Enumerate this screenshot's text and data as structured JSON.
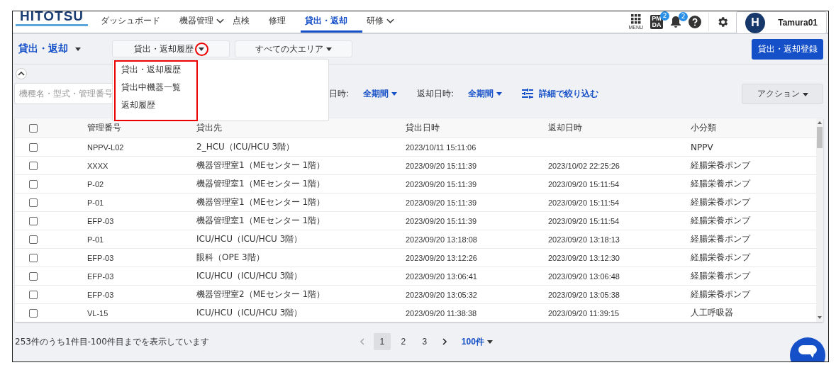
{
  "header": {
    "logo": "HITOTSU",
    "nav": [
      {
        "label": "ダッシュボード",
        "selected": false,
        "has_menu": false
      },
      {
        "label": "機器管理",
        "selected": false,
        "has_menu": true
      },
      {
        "label": "点検",
        "selected": false,
        "has_menu": false
      },
      {
        "label": "修理",
        "selected": false,
        "has_menu": false
      },
      {
        "label": "貸出・返却",
        "selected": true,
        "has_menu": false
      },
      {
        "label": "研修",
        "selected": false,
        "has_menu": true
      }
    ],
    "menu_label": "MENU",
    "pmda_label": "PMDA",
    "pmda_badge": "2",
    "bell_badge": "2",
    "avatar_letter": "H",
    "user": "Tamura01"
  },
  "page_title": "貸出・返却",
  "view_select": "貸出・返却履歴",
  "area_select": "すべての大エリア",
  "register_button": "貸出・返却登録",
  "view_menu": [
    {
      "label": "貸出・返却履歴"
    },
    {
      "label": "貸出中機器一覧"
    },
    {
      "label": "返却履歴"
    }
  ],
  "search": {
    "placeholder": "機種名・型式・管理番号"
  },
  "filters": [
    {
      "label": "日時:",
      "value": "全期間"
    },
    {
      "label": "返却日時:",
      "value": "全期間"
    }
  ],
  "detail_filter": "詳細で絞り込む",
  "action_button": "アクション",
  "table": {
    "columns": [
      "管理番号",
      "貸出先",
      "貸出日時",
      "返却日時",
      "小分類"
    ],
    "header_checked": false,
    "rows": [
      {
        "checked": false,
        "cells": [
          "NPPV-L02",
          "2_HCU（ICU/HCU 3階）",
          "2023/10/11 15:11:06",
          "",
          "NPPV"
        ]
      },
      {
        "checked": false,
        "cells": [
          "XXXX",
          "機器管理室1（MEセンター 1階）",
          "2023/09/20 15:11:39",
          "2023/10/02 22:25:26",
          "経腸栄養ポンプ"
        ]
      },
      {
        "checked": false,
        "cells": [
          "P-02",
          "機器管理室1（MEセンター 1階）",
          "2023/09/20 15:11:39",
          "2023/09/20 15:11:54",
          "経腸栄養ポンプ"
        ]
      },
      {
        "checked": false,
        "cells": [
          "P-01",
          "機器管理室1（MEセンター 1階）",
          "2023/09/20 15:11:39",
          "2023/09/20 15:11:54",
          "経腸栄養ポンプ"
        ]
      },
      {
        "checked": false,
        "cells": [
          "EFP-03",
          "機器管理室1（MEセンター 1階）",
          "2023/09/20 15:11:39",
          "2023/09/20 15:11:54",
          "経腸栄養ポンプ"
        ]
      },
      {
        "checked": false,
        "cells": [
          "P-01",
          "ICU/HCU（ICU/HCU 3階）",
          "2023/09/20 13:18:08",
          "2023/09/20 13:18:13",
          "経腸栄養ポンプ"
        ]
      },
      {
        "checked": false,
        "cells": [
          "EFP-03",
          "眼科（OPE 3階）",
          "2023/09/20 13:12:26",
          "2023/09/20 13:12:30",
          "経腸栄養ポンプ"
        ]
      },
      {
        "checked": false,
        "cells": [
          "EFP-03",
          "ICU/HCU（ICU/HCU 3階）",
          "2023/09/20 13:06:41",
          "2023/09/20 13:06:48",
          "経腸栄養ポンプ"
        ]
      },
      {
        "checked": false,
        "cells": [
          "EFP-03",
          "機器管理室2（MEセンター 1階）",
          "2023/09/20 13:05:32",
          "2023/09/20 13:05:38",
          "経腸栄養ポンプ"
        ]
      },
      {
        "checked": false,
        "cells": [
          "VL-15",
          "ICU/HCU（ICU/HCU 3階）",
          "2023/09/20 11:38:38",
          "2023/09/20 11:39:15",
          "人工呼吸器"
        ]
      }
    ]
  },
  "footer": {
    "summary": "253件のうち1件目-100件目までを表示しています",
    "pages": [
      {
        "label": "1",
        "selected": true
      },
      {
        "label": "2",
        "selected": false
      },
      {
        "label": "3",
        "selected": false
      }
    ],
    "page_size": "100件"
  }
}
